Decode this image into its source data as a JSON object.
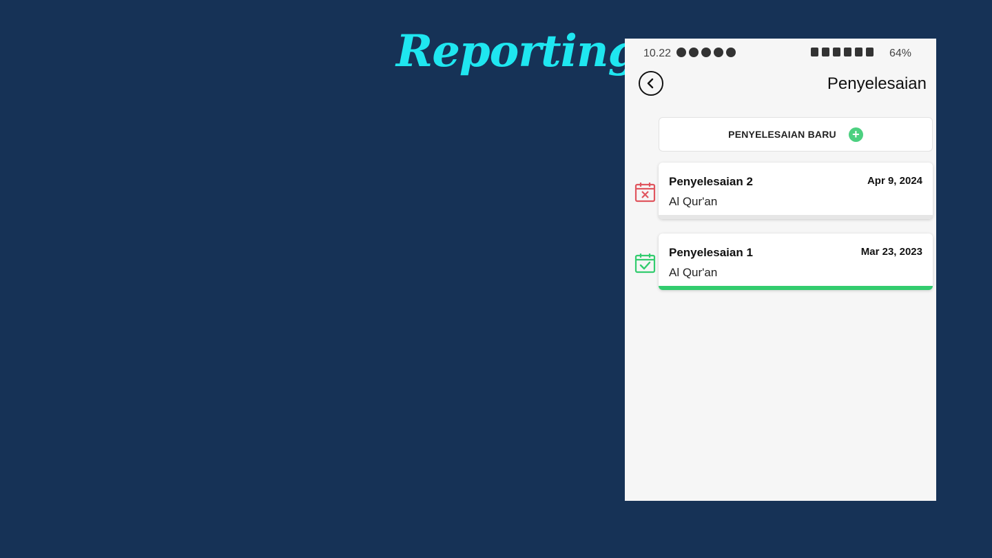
{
  "slide": {
    "title": "Reporting",
    "title_color": "#1fe6f0",
    "background": "#163256"
  },
  "status_bar": {
    "time": "10.22",
    "battery": "64%"
  },
  "header": {
    "title": "Penyelesaian"
  },
  "new_button": {
    "label": "PENYELESAIAN BARU",
    "accent": "#4cd080"
  },
  "items": [
    {
      "title": "Penyelesaian 2",
      "date": "Apr 9, 2024",
      "subtitle": "Al Qur'an",
      "status": "failed",
      "status_icon": "calendar-x-icon",
      "icon_color": "#e0555e",
      "progress": 0.0
    },
    {
      "title": "Penyelesaian 1",
      "date": "Mar 23, 2023",
      "subtitle": "Al Qur'an",
      "status": "completed",
      "status_icon": "calendar-check-icon",
      "icon_color": "#32cc6e",
      "progress": 1.0
    }
  ]
}
